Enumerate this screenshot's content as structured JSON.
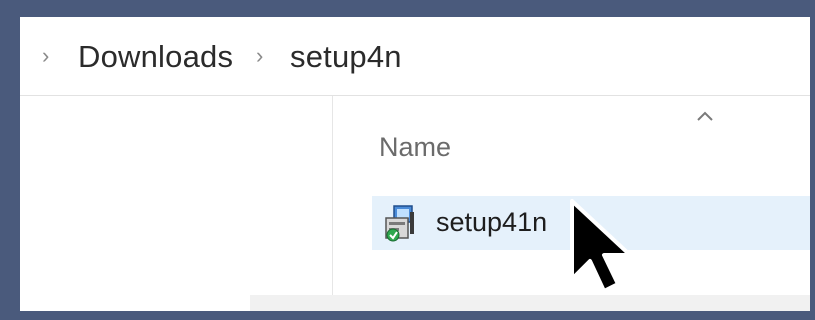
{
  "breadcrumb": {
    "items": [
      "Downloads",
      "setup4n"
    ],
    "separator": "›"
  },
  "file_list": {
    "column_header": "Name",
    "sort_direction": "ascending",
    "rows": [
      {
        "name": "setup41n",
        "icon": "installer-icon",
        "selected": false,
        "hovered": true
      }
    ]
  },
  "colors": {
    "frame_border": "#4a5a7c",
    "row_hover": "#e5f1fb"
  }
}
